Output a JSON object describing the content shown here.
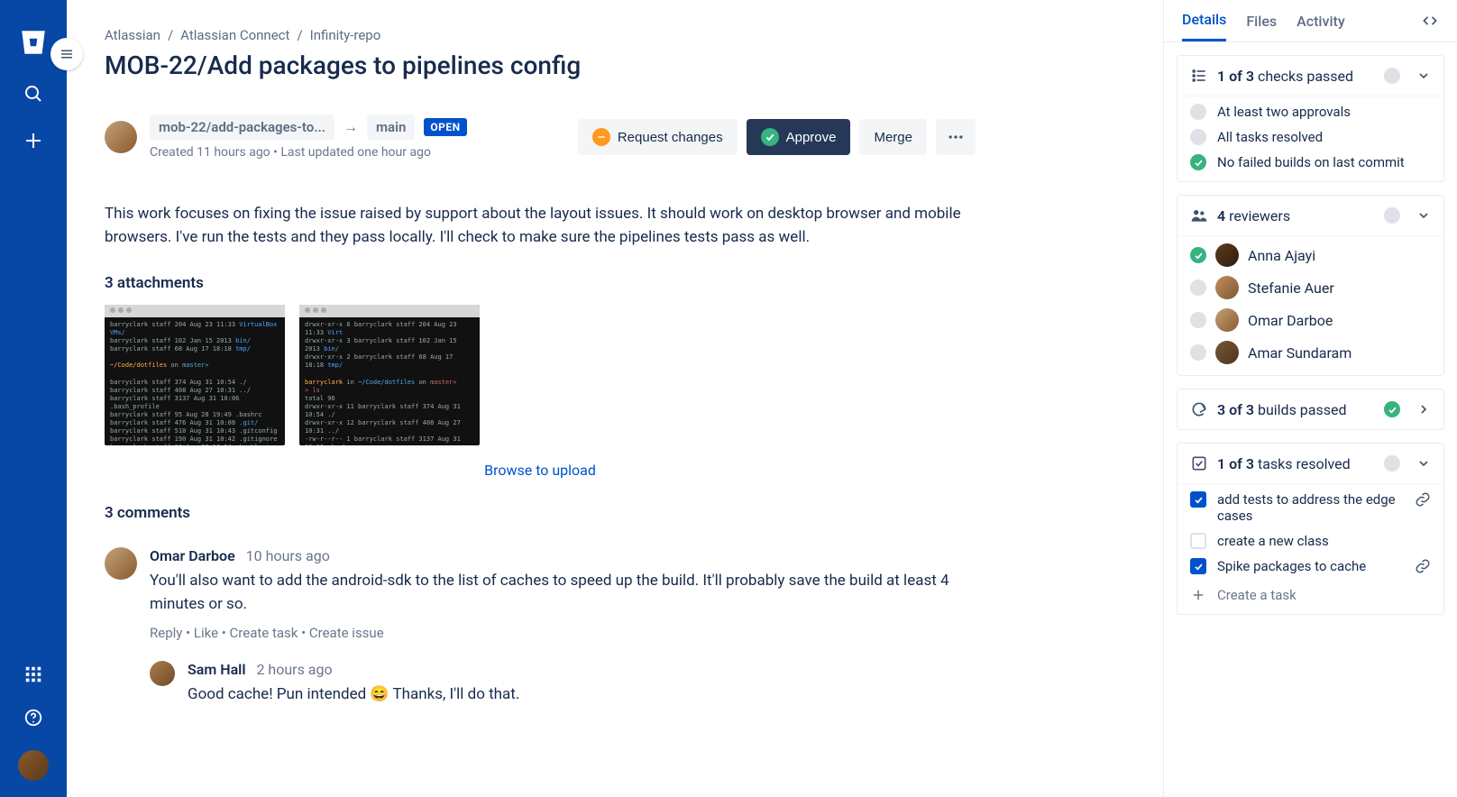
{
  "breadcrumb": [
    "Atlassian",
    "Atlassian Connect",
    "Infinity-repo"
  ],
  "title": "MOB-22/Add packages to pipelines config",
  "branch": {
    "source": "mob-22/add-packages-to...",
    "target": "main",
    "status": "OPEN"
  },
  "meta": "Created 11 hours ago • Last updated one hour ago",
  "actions": {
    "request": "Request changes",
    "approve": "Approve",
    "merge": "Merge"
  },
  "description": "This work focuses on fixing the issue raised by support about the layout issues. It should work on desktop browser and mobile browsers. I've run the tests and they pass locally. I'll check to make sure the pipelines tests pass as well.",
  "attachments": {
    "heading": "3 attachments",
    "browse": "Browse to upload"
  },
  "commentsHeading": "3 comments",
  "comments": [
    {
      "author": "Omar Darboe",
      "age": "10 hours ago",
      "text": "You'll also want to add the android-sdk to the list of caches to speed up the build. It'll probably save the build at least 4 minutes or so.",
      "ops": [
        "Reply",
        "Like",
        "Create task",
        "Create issue"
      ],
      "reply": {
        "author": "Sam Hall",
        "age": "2 hours ago",
        "text": "Good cache! Pun intended 😄 Thanks, I'll do that."
      }
    }
  ],
  "side": {
    "tabs": [
      "Details",
      "Files",
      "Activity"
    ],
    "checks": {
      "summary_strong": "1 of 3",
      "summary_rest": "checks passed",
      "items": [
        {
          "ok": false,
          "label": "At least two approvals"
        },
        {
          "ok": false,
          "label": "All tasks resolved"
        },
        {
          "ok": true,
          "label": "No failed builds on last commit"
        }
      ]
    },
    "reviewers": {
      "count": "4",
      "label": "reviewers",
      "items": [
        {
          "ok": true,
          "name": "Anna Ajayi"
        },
        {
          "ok": false,
          "name": "Stefanie Auer"
        },
        {
          "ok": false,
          "name": "Omar Darboe"
        },
        {
          "ok": false,
          "name": "Amar Sundaram"
        }
      ]
    },
    "builds": {
      "strong": "3 of 3",
      "rest": "builds passed"
    },
    "tasks": {
      "strong": "1 of 3",
      "rest": "tasks resolved",
      "items": [
        {
          "done": true,
          "label": "add tests to address the edge cases",
          "link": true
        },
        {
          "done": false,
          "label": "create a new class",
          "link": false
        },
        {
          "done": true,
          "label": "Spike packages to cache",
          "link": true
        }
      ],
      "create": "Create a task"
    }
  }
}
